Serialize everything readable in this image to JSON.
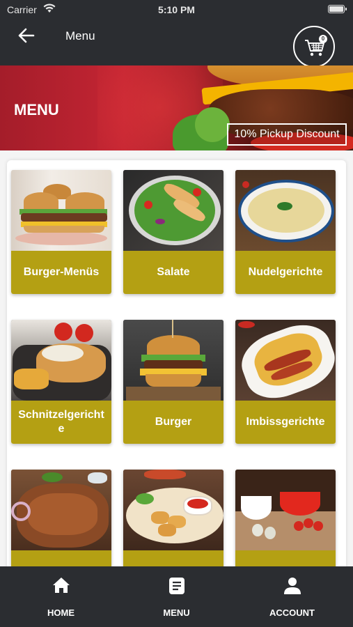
{
  "status_bar": {
    "carrier": "Carrier",
    "time": "5:10 PM"
  },
  "nav": {
    "title": "Menu",
    "back_icon": "arrow-left-icon",
    "cart_icon": "cart-icon",
    "cart_count": "0"
  },
  "banner": {
    "title": "MENU",
    "discount": "10% Pickup Discount"
  },
  "categories": [
    {
      "label": "Burger-Menüs"
    },
    {
      "label": "Salate"
    },
    {
      "label": "Nudelgerichte"
    },
    {
      "label": "Schnitzelgericht e"
    },
    {
      "label": "Burger"
    },
    {
      "label": "Imbissgerichte"
    },
    {
      "label": ""
    },
    {
      "label": ""
    },
    {
      "label": ""
    }
  ],
  "tabs": [
    {
      "label": "HOME",
      "icon": "home-icon"
    },
    {
      "label": "MENU",
      "icon": "menu-icon"
    },
    {
      "label": "ACCOUNT",
      "icon": "account-icon"
    }
  ],
  "colors": {
    "bar": "#2b2d31",
    "accent": "#b4a013",
    "banner_red": "#c42533"
  }
}
